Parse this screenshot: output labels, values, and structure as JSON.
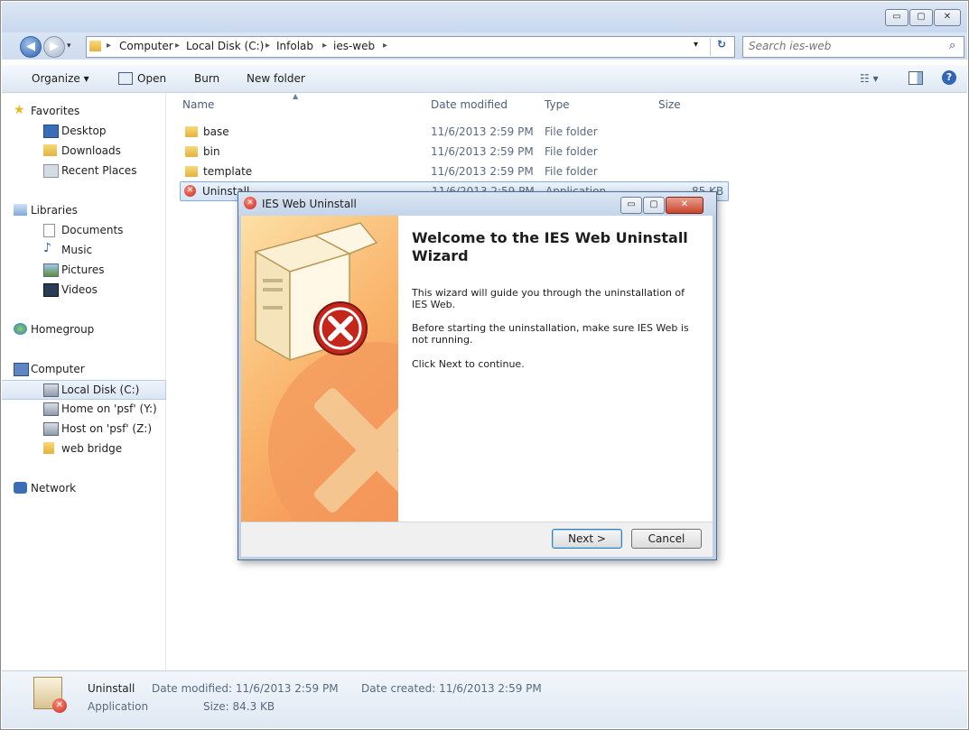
{
  "window": {
    "controls": {
      "minimize": "▭",
      "maximize": "▢",
      "close": "✕"
    }
  },
  "address": {
    "crumbs": [
      "Computer",
      "Local Disk (C:)",
      "Infolab",
      "ies-web"
    ],
    "search_placeholder": "Search ies-web"
  },
  "toolbar": {
    "organize": "Organize ▾",
    "open": "Open",
    "burn": "Burn",
    "new_folder": "New folder"
  },
  "navpane": {
    "favorites": "Favorites",
    "desktop": "Desktop",
    "downloads": "Downloads",
    "recent": "Recent Places",
    "libraries": "Libraries",
    "documents": "Documents",
    "music": "Music",
    "pictures": "Pictures",
    "videos": "Videos",
    "homegroup": "Homegroup",
    "computer": "Computer",
    "localdisk": "Local Disk (C:)",
    "home_psf": "Home on 'psf' (Y:)",
    "host_psf": "Host on 'psf' (Z:)",
    "webbridge": "web bridge",
    "network": "Network"
  },
  "columns": {
    "name": "Name",
    "date": "Date modified",
    "type": "Type",
    "size": "Size"
  },
  "files": [
    {
      "name": "base",
      "date": "11/6/2013 2:59 PM",
      "type": "File folder",
      "size": ""
    },
    {
      "name": "bin",
      "date": "11/6/2013 2:59 PM",
      "type": "File folder",
      "size": ""
    },
    {
      "name": "template",
      "date": "11/6/2013 2:59 PM",
      "type": "File folder",
      "size": ""
    },
    {
      "name": "Uninstall",
      "date": "11/6/2013 2:59 PM",
      "type": "Application",
      "size": "85 KB"
    }
  ],
  "details": {
    "name": "Uninstall",
    "kind": "Application",
    "modified": "Date modified: 11/6/2013 2:59 PM",
    "size": "Size: 84.3 KB",
    "created": "Date created: 11/6/2013 2:59 PM"
  },
  "dialog": {
    "title": "IES Web Uninstall",
    "heading": "Welcome to the IES Web Uninstall Wizard",
    "p1": "This wizard will guide you through the uninstallation of IES Web.",
    "p2": "Before starting the uninstallation, make sure IES Web is not running.",
    "p3": "Click Next to continue.",
    "next": "Next >",
    "cancel": "Cancel"
  }
}
